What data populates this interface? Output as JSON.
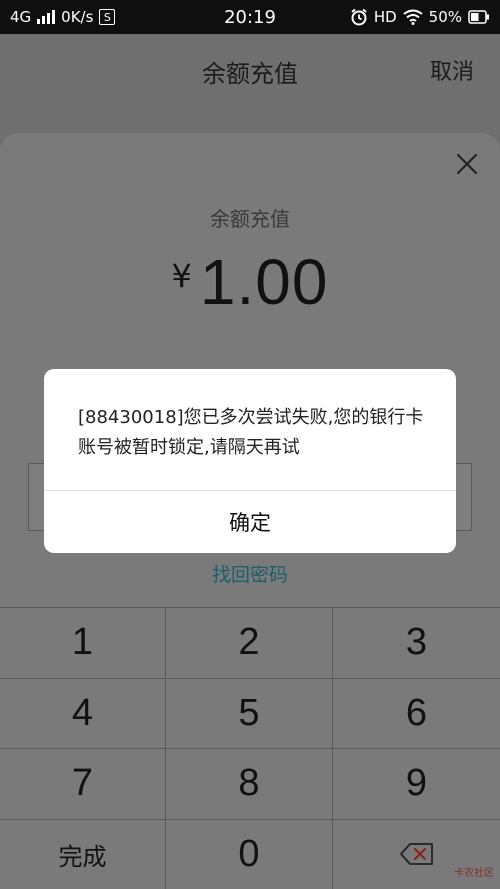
{
  "status_bar": {
    "network": "4G",
    "speed": "0K/s",
    "sim_badge": "S",
    "time": "20:19",
    "hd": "HD",
    "battery": "50%",
    "icons": [
      "signal-icon",
      "alarm-icon",
      "wifi-icon",
      "battery-icon"
    ]
  },
  "header": {
    "title": "余额充值",
    "cancel": "取消"
  },
  "sheet": {
    "title": "余额充值",
    "currency": "¥",
    "amount": "1.00",
    "forgot_password": "找回密码",
    "close_icon": "close-icon"
  },
  "dialog": {
    "message": "[88430018]您已多次尝试失败,您的银行卡账号被暂时锁定,请隔天再试",
    "ok": "确定"
  },
  "keypad": {
    "keys": [
      "1",
      "2",
      "3",
      "4",
      "5",
      "6",
      "7",
      "8",
      "9",
      "完成",
      "0"
    ],
    "backspace_icon": "backspace-icon",
    "watermark": "卡农社区"
  },
  "colors": {
    "overlay_bg": "#6f6f6f",
    "status_bar_bg": "#0f0f0f",
    "link": "#1b5e6e",
    "dialog_bg": "#ffffff"
  }
}
